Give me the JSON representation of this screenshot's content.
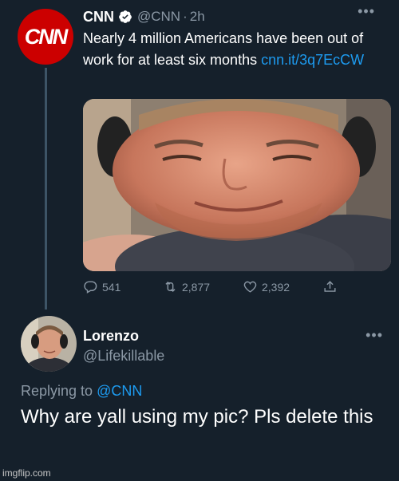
{
  "tweet": {
    "name": "CNN",
    "handle": "@CNN",
    "separator": "·",
    "time": "2h",
    "avatar_text": "CNN",
    "text": "Nearly 4 million Americans have been out of work for at least six months ",
    "link": "cnn.it/3q7EcCW",
    "actions": {
      "replies": "541",
      "retweets": "2,877",
      "likes": "2,392"
    },
    "colors": {
      "brand": "#cc0000",
      "link": "#1d9bf0",
      "verified": "#1d9bf0"
    }
  },
  "reply": {
    "name": "Lorenzo",
    "handle": "@Lifekillable",
    "replying_prefix": "Replying to ",
    "replying_to": "@CNN",
    "text": "Why are yall using my pic? Pls delete this"
  },
  "watermark": "imgflip.com",
  "icons": [
    "verified-badge-icon",
    "more-icon",
    "reply-icon",
    "retweet-icon",
    "like-icon",
    "share-icon"
  ]
}
